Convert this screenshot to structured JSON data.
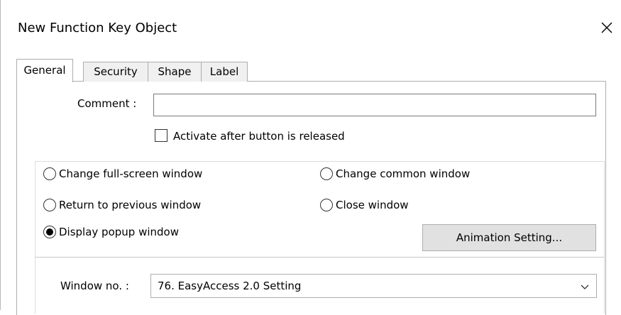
{
  "window": {
    "title": "New Function Key Object"
  },
  "tabs": [
    {
      "label": "General",
      "active": true
    },
    {
      "label": "Security",
      "active": false
    },
    {
      "label": "Shape",
      "active": false
    },
    {
      "label": "Label",
      "active": false
    }
  ],
  "comment": {
    "label": "Comment :",
    "value": ""
  },
  "activate_checkbox": {
    "label": "Activate after button is released",
    "checked": false
  },
  "radios": [
    {
      "label": "Change full-screen window",
      "selected": false
    },
    {
      "label": "Change common window",
      "selected": false
    },
    {
      "label": "Return to previous window",
      "selected": false
    },
    {
      "label": "Close window",
      "selected": false
    },
    {
      "label": "Display popup window",
      "selected": true
    }
  ],
  "animation_button": {
    "label": "Animation Setting..."
  },
  "window_no": {
    "label": "Window no. :",
    "selected": "76. EasyAccess 2.0 Setting"
  },
  "icons": {
    "close": "close-icon",
    "dropdown": "chevron-down-icon"
  }
}
